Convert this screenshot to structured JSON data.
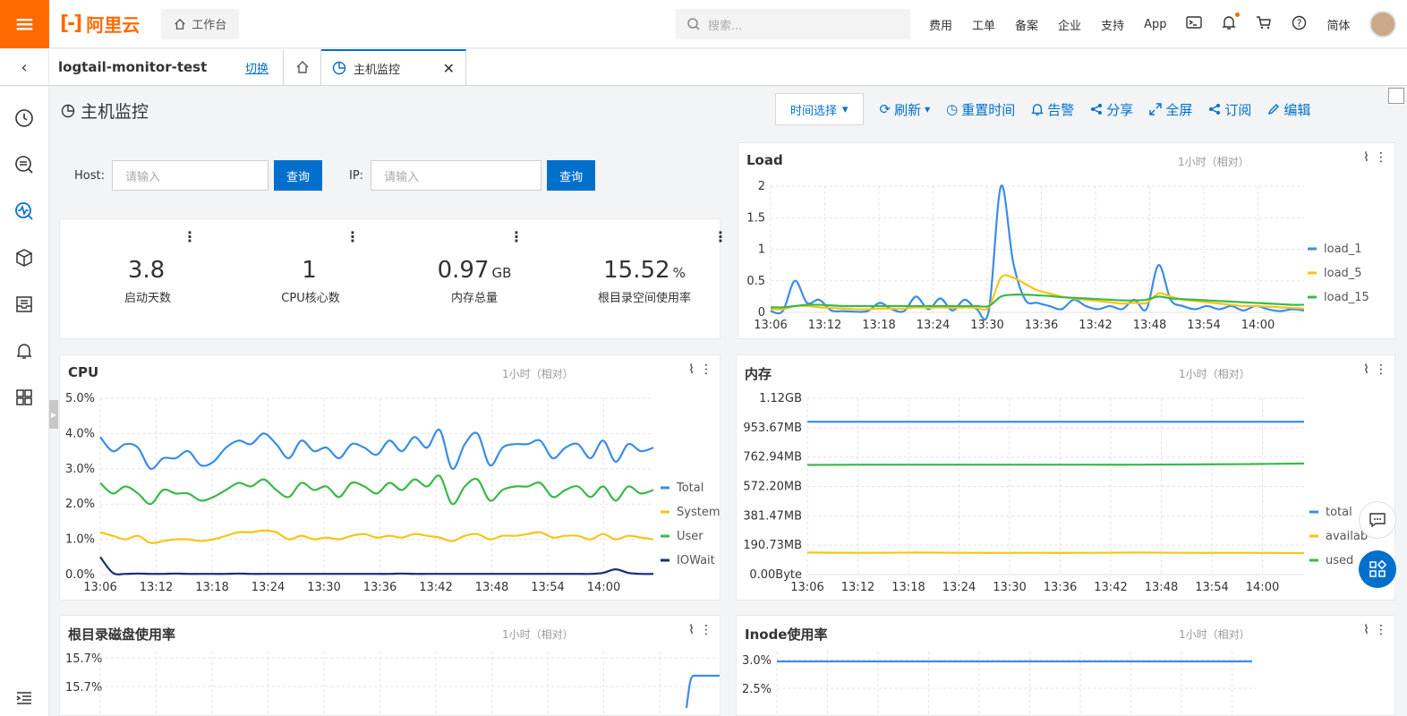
{
  "topbar": {
    "brand": "阿里云",
    "workbench": "工作台",
    "search_placeholder": "搜索...",
    "links": [
      "费用",
      "工单",
      "备案",
      "企业",
      "支持",
      "App"
    ],
    "lang": "简体"
  },
  "tabbar": {
    "project": "logtail-monitor-test",
    "switch": "切换",
    "active_tab": "主机监控"
  },
  "page": {
    "title": "主机监控",
    "toolbar": {
      "time_select": "时间选择",
      "refresh": "刷新",
      "reset_time": "重置时间",
      "alert": "告警",
      "share": "分享",
      "fullscreen": "全屏",
      "subscribe": "订阅",
      "edit": "编辑"
    },
    "query": {
      "host_label": "Host:",
      "host_placeholder": "请输入",
      "ip_label": "IP:",
      "ip_placeholder": "请输入",
      "query_btn": "查询"
    }
  },
  "kpis": [
    {
      "value": "3.8",
      "unit": "",
      "label": "启动天数"
    },
    {
      "value": "1",
      "unit": "",
      "label": "CPU核心数"
    },
    {
      "value": "0.97",
      "unit": "GB",
      "label": "内存总量"
    },
    {
      "value": "15.52",
      "unit": "%",
      "label": "根目录空间使用率"
    }
  ],
  "range_label": "1小时（相对）",
  "colors": {
    "blue": "#3b8de6",
    "yellow": "#f5c518",
    "green": "#3cb84a",
    "navy": "#1a2f7a",
    "accent": "#0070cc",
    "brand": "#ff6a00"
  },
  "chart_data": [
    {
      "id": "load",
      "type": "line",
      "title": "Load",
      "x": [
        "13:06",
        "13:12",
        "13:18",
        "13:24",
        "13:30",
        "13:36",
        "13:42",
        "13:48",
        "13:54",
        "14:00"
      ],
      "y_ticks": [
        "0",
        "0.5",
        "1",
        "1.5",
        "2"
      ],
      "ylim": [
        0,
        2
      ],
      "series": [
        {
          "name": "load_1",
          "color": "#3b8de6",
          "values": [
            0.02,
            0.02,
            0.5,
            0.15,
            0.2,
            0.03,
            0.02,
            0.01,
            0.02,
            0.15,
            0.05,
            0.02,
            0.25,
            0.05,
            0.22,
            0.03,
            0.2,
            0.05,
            0.03,
            2.0,
            0.8,
            0.2,
            0.15,
            0.1,
            0.05,
            0.2,
            0.1,
            0.05,
            0.1,
            0.05,
            0.2,
            0.05,
            0.75,
            0.2,
            0.1,
            0.05,
            0.1,
            0.05,
            0.1,
            0.03,
            0.1,
            0.05,
            0.02,
            0.05,
            0.03
          ]
        },
        {
          "name": "load_5",
          "color": "#f5c518",
          "values": [
            0.05,
            0.05,
            0.1,
            0.1,
            0.08,
            0.07,
            0.06,
            0.05,
            0.05,
            0.06,
            0.06,
            0.06,
            0.08,
            0.07,
            0.08,
            0.07,
            0.08,
            0.07,
            0.08,
            0.55,
            0.55,
            0.45,
            0.35,
            0.3,
            0.25,
            0.22,
            0.2,
            0.18,
            0.16,
            0.14,
            0.15,
            0.15,
            0.3,
            0.25,
            0.2,
            0.18,
            0.16,
            0.14,
            0.12,
            0.1,
            0.1,
            0.09,
            0.08,
            0.07,
            0.06
          ]
        },
        {
          "name": "load_15",
          "color": "#3cb84a",
          "values": [
            0.08,
            0.08,
            0.1,
            0.12,
            0.12,
            0.11,
            0.1,
            0.1,
            0.1,
            0.1,
            0.1,
            0.1,
            0.1,
            0.1,
            0.1,
            0.1,
            0.1,
            0.1,
            0.1,
            0.25,
            0.28,
            0.28,
            0.27,
            0.26,
            0.24,
            0.23,
            0.22,
            0.21,
            0.2,
            0.19,
            0.19,
            0.2,
            0.25,
            0.22,
            0.21,
            0.2,
            0.19,
            0.18,
            0.17,
            0.16,
            0.15,
            0.14,
            0.13,
            0.12,
            0.12
          ]
        }
      ]
    },
    {
      "id": "cpu",
      "type": "line",
      "title": "CPU",
      "x": [
        "13:06",
        "13:12",
        "13:18",
        "13:24",
        "13:30",
        "13:36",
        "13:42",
        "13:48",
        "13:54",
        "14:00"
      ],
      "y_ticks": [
        "0.0%",
        "1.0%",
        "2.0%",
        "3.0%",
        "4.0%",
        "5.0%"
      ],
      "ylim": [
        0,
        5
      ],
      "series": [
        {
          "name": "Total",
          "color": "#3b8de6",
          "values": [
            3.9,
            3.5,
            3.7,
            3.6,
            3.0,
            3.3,
            3.3,
            3.5,
            3.1,
            3.2,
            3.6,
            3.8,
            3.7,
            4.0,
            3.7,
            3.3,
            3.8,
            3.5,
            3.6,
            3.3,
            3.7,
            3.6,
            3.4,
            3.8,
            3.5,
            3.9,
            3.6,
            4.1,
            3.0,
            3.7,
            4.0,
            3.1,
            3.6,
            3.7,
            3.7,
            3.8,
            3.3,
            3.6,
            3.7,
            3.3,
            3.8,
            3.2,
            3.7,
            3.5,
            3.6
          ]
        },
        {
          "name": "System",
          "color": "#f5c518",
          "values": [
            1.2,
            1.1,
            1.0,
            1.1,
            0.9,
            0.95,
            1.0,
            1.0,
            0.95,
            1.0,
            1.1,
            1.2,
            1.2,
            1.25,
            1.2,
            1.0,
            1.1,
            1.0,
            1.05,
            1.0,
            1.1,
            1.15,
            1.05,
            1.1,
            1.05,
            1.15,
            1.1,
            1.05,
            0.95,
            1.1,
            1.15,
            1.0,
            1.1,
            1.1,
            1.15,
            1.2,
            1.05,
            1.1,
            1.1,
            1.0,
            1.15,
            1.0,
            1.1,
            1.05,
            1.0
          ]
        },
        {
          "name": "User",
          "color": "#3cb84a",
          "values": [
            2.6,
            2.3,
            2.5,
            2.3,
            2.0,
            2.4,
            2.3,
            2.3,
            2.1,
            2.2,
            2.4,
            2.6,
            2.5,
            2.7,
            2.4,
            2.2,
            2.6,
            2.4,
            2.5,
            2.2,
            2.6,
            2.5,
            2.3,
            2.6,
            2.4,
            2.7,
            2.5,
            2.8,
            2.0,
            2.5,
            2.7,
            2.1,
            2.4,
            2.5,
            2.5,
            2.6,
            2.2,
            2.4,
            2.5,
            2.2,
            2.5,
            2.1,
            2.5,
            2.3,
            2.4
          ]
        },
        {
          "name": "IOWait",
          "color": "#1a2f7a",
          "values": [
            0.5,
            0.05,
            0.02,
            0.03,
            0.02,
            0.02,
            0.03,
            0.02,
            0.02,
            0.02,
            0.02,
            0.03,
            0.02,
            0.02,
            0.02,
            0.02,
            0.02,
            0.02,
            0.02,
            0.02,
            0.02,
            0.02,
            0.02,
            0.02,
            0.03,
            0.02,
            0.02,
            0.02,
            0.02,
            0.02,
            0.02,
            0.02,
            0.02,
            0.02,
            0.02,
            0.02,
            0.02,
            0.02,
            0.02,
            0.02,
            0.05,
            0.15,
            0.05,
            0.02,
            0.02
          ]
        }
      ]
    },
    {
      "id": "memory",
      "type": "line",
      "title": "内存",
      "x": [
        "13:06",
        "13:12",
        "13:18",
        "13:24",
        "13:30",
        "13:36",
        "13:42",
        "13:48",
        "13:54",
        "14:00"
      ],
      "y_ticks": [
        "0.00Byte",
        "190.73MB",
        "381.47MB",
        "572.20MB",
        "762.94MB",
        "953.67MB",
        "1.12GB"
      ],
      "ylim": [
        0,
        6
      ],
      "series": [
        {
          "name": "total",
          "color": "#3b8de6",
          "values": [
            5.2,
            5.2,
            5.2,
            5.2,
            5.2,
            5.2,
            5.2,
            5.2,
            5.2,
            5.2
          ]
        },
        {
          "name": "available",
          "color": "#f5c518",
          "values": [
            0.75,
            0.74,
            0.75,
            0.74,
            0.74,
            0.74,
            0.75,
            0.74,
            0.74,
            0.73
          ]
        },
        {
          "name": "used",
          "color": "#3cb84a",
          "values": [
            3.73,
            3.74,
            3.74,
            3.74,
            3.74,
            3.74,
            3.74,
            3.75,
            3.76,
            3.78
          ]
        }
      ],
      "legend": [
        "total",
        "availab",
        "used"
      ]
    },
    {
      "id": "disk",
      "type": "line",
      "title": "根目录磁盘使用率",
      "y_ticks": [
        "15.7%",
        "15.7%"
      ]
    },
    {
      "id": "inode",
      "type": "line",
      "title": "Inode使用率",
      "y_ticks": [
        "3.0%",
        "2.5%"
      ]
    }
  ]
}
